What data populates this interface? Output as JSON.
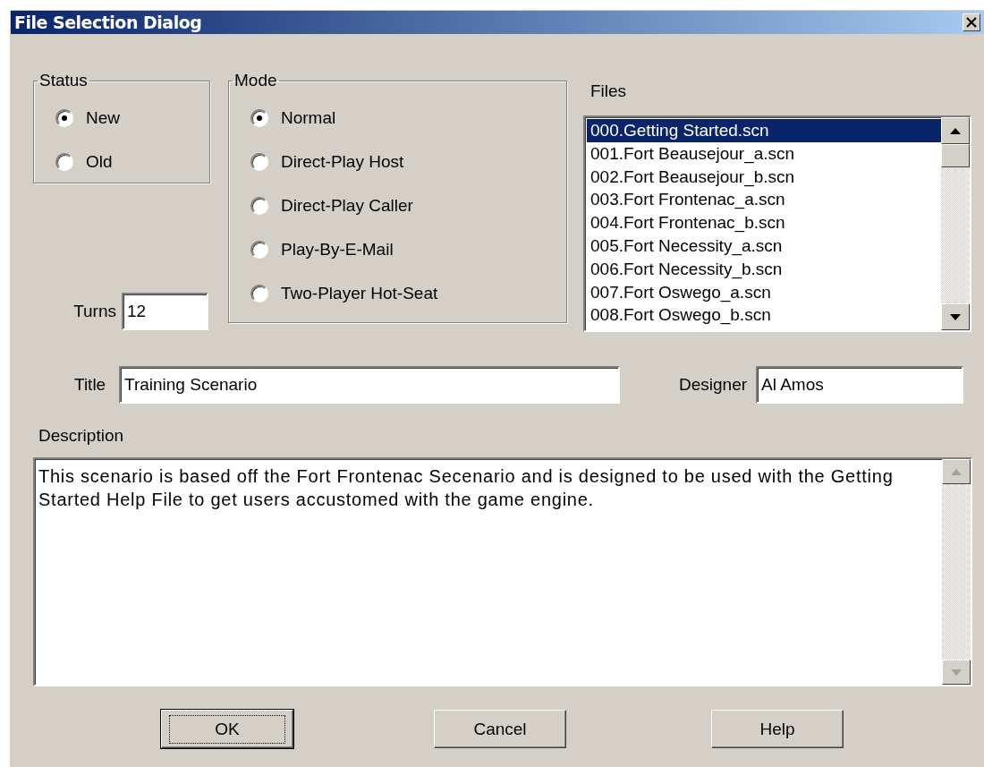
{
  "window": {
    "title": "File Selection Dialog"
  },
  "status": {
    "legend": "Status",
    "options": [
      {
        "label": "New",
        "selected": true
      },
      {
        "label": "Old",
        "selected": false
      }
    ]
  },
  "mode": {
    "legend": "Mode",
    "options": [
      {
        "label": "Normal",
        "selected": true
      },
      {
        "label": "Direct-Play Host",
        "selected": false
      },
      {
        "label": "Direct-Play Caller",
        "selected": false
      },
      {
        "label": "Play-By-E-Mail",
        "selected": false
      },
      {
        "label": "Two-Player Hot-Seat",
        "selected": false
      }
    ]
  },
  "turns": {
    "label": "Turns",
    "value": "12"
  },
  "files": {
    "label": "Files",
    "items": [
      {
        "name": "000.Getting Started.scn",
        "selected": true
      },
      {
        "name": "001.Fort Beausejour_a.scn",
        "selected": false
      },
      {
        "name": "002.Fort Beausejour_b.scn",
        "selected": false
      },
      {
        "name": "003.Fort Frontenac_a.scn",
        "selected": false
      },
      {
        "name": "004.Fort Frontenac_b.scn",
        "selected": false
      },
      {
        "name": "005.Fort Necessity_a.scn",
        "selected": false
      },
      {
        "name": "006.Fort Necessity_b.scn",
        "selected": false
      },
      {
        "name": "007.Fort Oswego_a.scn",
        "selected": false
      },
      {
        "name": "008.Fort Oswego_b.scn",
        "selected": false
      }
    ]
  },
  "title_field": {
    "label": "Title",
    "value": "Training Scenario"
  },
  "designer_field": {
    "label": "Designer",
    "value": "Al Amos"
  },
  "description": {
    "label": "Description",
    "value": "This scenario is based off the Fort Frontenac Secenario and is designed to be used with the Getting Started Help File to get users accustomed with the game engine."
  },
  "buttons": [
    {
      "label": "OK",
      "default": true
    },
    {
      "label": "Cancel",
      "default": false
    },
    {
      "label": "Help",
      "default": false
    }
  ]
}
